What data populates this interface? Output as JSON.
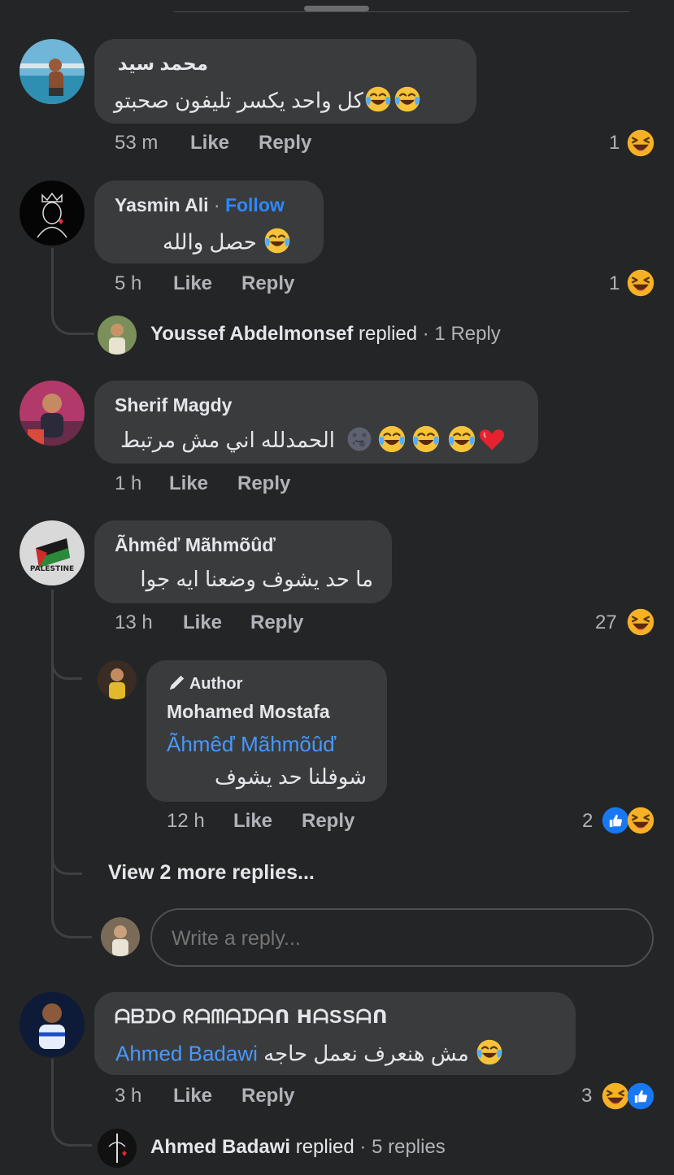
{
  "comments": [
    {
      "author": "محمد سيد",
      "text": "كل واحد يكسر تليفون صحبتو",
      "time": "53 m",
      "like": "Like",
      "reply": "Reply",
      "reaction_count": "1",
      "reactions": [
        "haha"
      ]
    },
    {
      "author": "Yasmin Ali",
      "follow": "Follow",
      "text": "حصل والله",
      "time": "5 h",
      "like": "Like",
      "reply": "Reply",
      "reaction_count": "1",
      "reactions": [
        "haha"
      ],
      "replied_summary": {
        "name": "Youssef Abdelmonsef",
        "verb": "replied",
        "count": "· 1 Reply"
      }
    },
    {
      "author": "Sherif Magdy",
      "text": "الحمدلله اني مش مرتبط",
      "time": "1 h",
      "like": "Like",
      "reply": "Reply"
    },
    {
      "author": "Ãhmêď Mãhmõûď",
      "text": "ما حد يشوف وضعنا ايه جوا",
      "time": "13 h",
      "like": "Like",
      "reply": "Reply",
      "reaction_count": "27",
      "reactions": [
        "haha"
      ],
      "avatar_text": "PALESTINE",
      "nested_reply": {
        "badge": "Author",
        "author": "Mohamed Mostafa",
        "mention": "Ãhmêď Mãhmõûď",
        "text": "شوفلنا حد يشوف",
        "time": "12 h",
        "like": "Like",
        "reply": "Reply",
        "reaction_count": "2",
        "reactions": [
          "like",
          "haha"
        ]
      },
      "view_more": "View 2 more replies...",
      "reply_input_placeholder": "Write a reply..."
    },
    {
      "author": "ᗩᗷᗪO ᖇᗩᗰᗩᗪᗩᑎ ᕼᗩSSᗩᑎ",
      "text": "مش هنعرف نعمل حاجه",
      "mention": "Ahmed Badawi",
      "time": "3 h",
      "like": "Like",
      "reply": "Reply",
      "reaction_count": "3",
      "reactions": [
        "haha",
        "like"
      ],
      "replied_summary": {
        "name": "Ahmed Badawi",
        "verb": "replied",
        "count": "· 5 replies"
      }
    }
  ],
  "colors": {
    "background": "#242526",
    "bubble": "#3a3b3c",
    "link": "#4599ff",
    "haha": "#f7b125",
    "like": "#1877f2"
  }
}
